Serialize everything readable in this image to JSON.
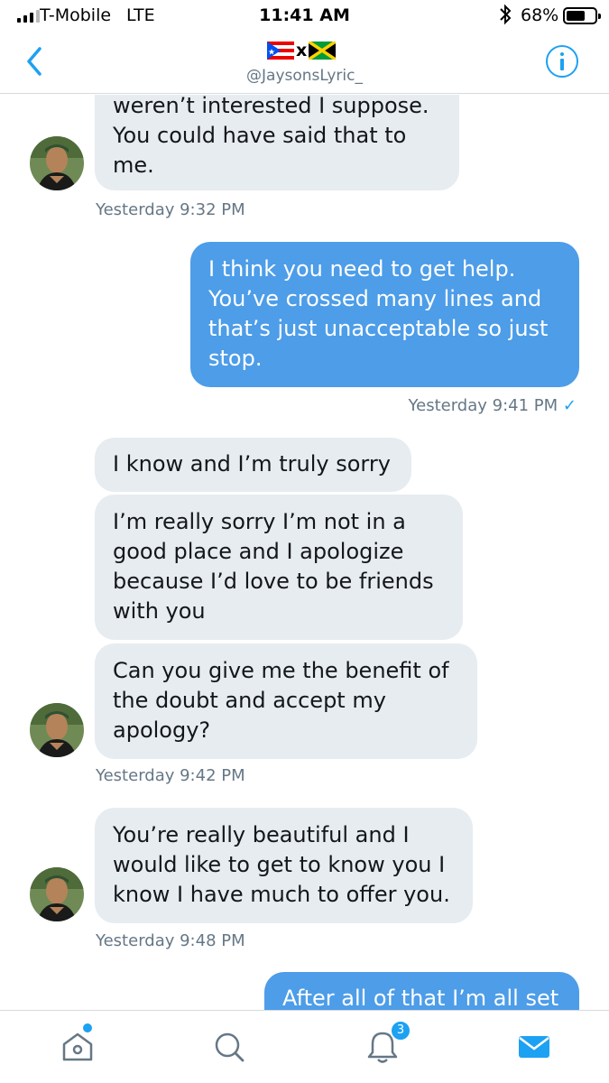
{
  "status_bar": {
    "carrier": "T-Mobile",
    "network": "LTE",
    "time": "11:41 AM",
    "battery_percent": "68%",
    "battery_level": 0.68
  },
  "header": {
    "handle": "@JaysonsLyric_",
    "flag_separator": "x",
    "flags": [
      "puerto-rico-flag-icon",
      "jamaica-flag-icon"
    ]
  },
  "messages": [
    {
      "side": "in",
      "lines": [
        "weren’t interested I suppose.",
        "You could have said that to",
        "me."
      ],
      "timestamp": "Yesterday 9:32 PM"
    },
    {
      "side": "out",
      "lines": [
        "I think you need to get help.",
        "You’ve crossed many lines and",
        "that’s just unacceptable so just",
        "stop."
      ],
      "timestamp": "Yesterday 9:41 PM",
      "read_mark": "✓"
    },
    {
      "side": "in",
      "lines": [
        "I know and I’m truly sorry"
      ]
    },
    {
      "side": "in",
      "lines": [
        "I’m really sorry I’m not in a",
        "good place and I apologize",
        "because I’d love to be friends",
        "with you"
      ]
    },
    {
      "side": "in",
      "lines": [
        "Can you give me the benefit of",
        "the doubt and accept my",
        "apology?"
      ],
      "timestamp": "Yesterday 9:42 PM"
    },
    {
      "side": "in",
      "lines": [
        "You’re really beautiful and I",
        "would like to get to know you I",
        "know I have much to offer you."
      ],
      "timestamp": "Yesterday 9:48 PM"
    },
    {
      "side": "out",
      "lines": [
        "After all of that I’m all set"
      ]
    }
  ],
  "tab_bar": {
    "notifications_badge": "3",
    "icons": [
      "home-icon",
      "search-icon",
      "notifications-icon",
      "messages-icon"
    ]
  },
  "colors": {
    "accent": "#1da1f2",
    "outgoing_bubble": "#4d9de8",
    "incoming_bubble": "#e6ecf0"
  }
}
